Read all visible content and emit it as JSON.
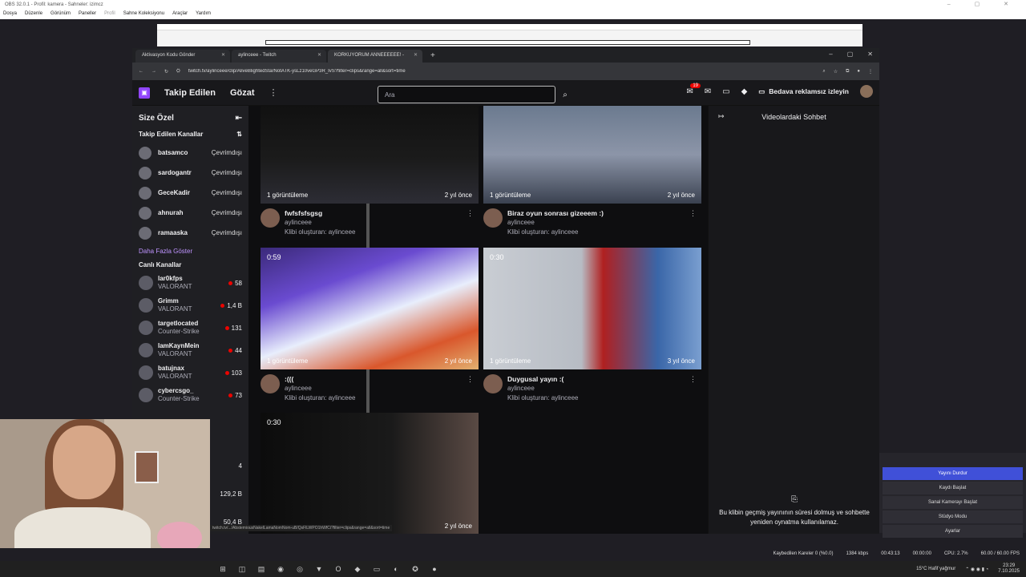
{
  "obs": {
    "title": "OBS 32.0.1 - Profil: kamera - Sahneler: izimcz",
    "menu": [
      "Dosya",
      "Düzenle",
      "Görünüm",
      "Paneller",
      "Profil",
      "Sahne Koleksiyonu",
      "Araçlar",
      "Yardım"
    ],
    "controls": [
      "Yayını Durdur",
      "Kaydı Başlat",
      "Sanal Kamerayı Başlat",
      "Stüdyo Modu",
      "Ayarlar"
    ],
    "status": {
      "dropped": "Kaybedilen Kareler 0 (%0.0)",
      "bitrate": "1384 kbps",
      "live_time": "00:43:13",
      "rec_time": "00:00:00",
      "cpu": "CPU: 2.7%",
      "fps": "60.00 / 60.00 FPS"
    }
  },
  "browser": {
    "tabs": [
      {
        "label": "Aktivasyon Kodu Gönder"
      },
      {
        "label": "aylinceee - Twitch"
      },
      {
        "label": "KORKUYORUM ANNEEEEEE! -"
      }
    ],
    "url": "twitch.tv/aylinceee/clip/AliveBlightedStarNotATK-ysLz10veGP3R_IvS?filter=clips&range=all&sort=time",
    "status_url": "twitch.tv/.../AbstemiousNakelLamaNomNom-uB/QsFlLWPO1hWfCi?filter=clips&range=all&sort=time"
  },
  "twitch": {
    "nav": {
      "following": "Takip Edilen",
      "browse": "Gözat",
      "search_placeholder": "Ara",
      "notifications": "19",
      "prime": "Bedava reklamsız izleyin"
    },
    "sidebar": {
      "for_you": "Size Özel",
      "followed_title": "Takip Edilen Kanallar",
      "followed": [
        {
          "name": "batsamco",
          "status": "Çevrimdışı"
        },
        {
          "name": "sardogantr",
          "status": "Çevrimdışı"
        },
        {
          "name": "GeceKadir",
          "status": "Çevrimdışı"
        },
        {
          "name": "ahnurah",
          "status": "Çevrimdışı"
        },
        {
          "name": "ramaaska",
          "status": "Çevrimdışı"
        }
      ],
      "show_more": "Daha Fazla Göster",
      "live_title": "Canlı Kanallar",
      "live": [
        {
          "name": "lar0kfps",
          "game": "VALORANT",
          "viewers": "58"
        },
        {
          "name": "Grimm",
          "game": "VALORANT",
          "viewers": "1,4 B"
        },
        {
          "name": "targetlocated",
          "game": "Counter-Strike",
          "viewers": "131"
        },
        {
          "name": "IamKaynMein",
          "game": "VALORANT",
          "viewers": "44"
        },
        {
          "name": "batujnax",
          "game": "VALORANT",
          "viewers": "103"
        },
        {
          "name": "cybercsgo_",
          "game": "Counter-Strike",
          "viewers": "73"
        }
      ],
      "extra_viewers": [
        "4",
        "129,2 B",
        "50,4 B"
      ]
    },
    "clips": [
      {
        "title": "fwfsfsfsgsg",
        "channel": "aylinceee",
        "by": "Klibi oluşturan: aylinceee",
        "views": "1 görüntüleme",
        "ago": "2 yıl önce",
        "duration": ""
      },
      {
        "title": "Biraz oyun sonrası gizeeem :)",
        "channel": "aylinceee",
        "by": "Klibi oluşturan: aylinceee",
        "views": "1 görüntüleme",
        "ago": "2 yıl önce",
        "duration": ""
      },
      {
        "title": ":(((",
        "channel": "aylinceee",
        "by": "Klibi oluşturan: aylinceee",
        "views": "1 görüntüleme",
        "ago": "2 yıl önce",
        "duration": "0:59"
      },
      {
        "title": "Duygusal yayın :(",
        "channel": "aylinceee",
        "by": "Klibi oluşturan: aylinceee",
        "views": "1 görüntüleme",
        "ago": "3 yıl önce",
        "duration": "0:30"
      },
      {
        "title": "",
        "channel": "",
        "by": "",
        "views": "",
        "ago": "2 yıl önce",
        "duration": "0:30"
      }
    ],
    "chat": {
      "title": "Videolardaki Sohbet",
      "message": "Bu klibin geçmiş yayınının süresi dolmuş ve sohbette yeniden oynatma kullanılamaz."
    }
  },
  "taskbar": {
    "weather": "15°C Hafif yağmur",
    "time": "23:29",
    "date": "7.10.2025"
  },
  "colors": {
    "twitch_purple": "#9146ff",
    "obs_primary": "#4050d8",
    "live_red": "#eb0400"
  }
}
